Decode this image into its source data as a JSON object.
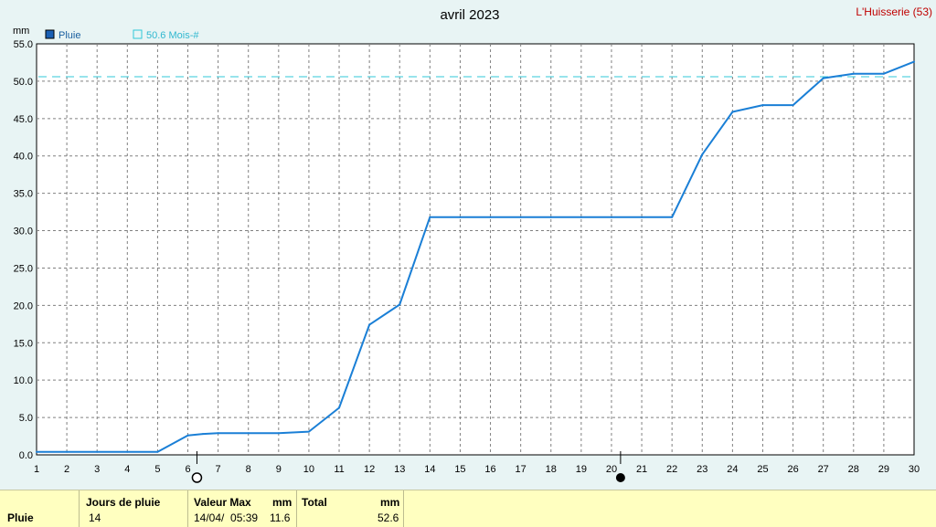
{
  "title": "avril 2023",
  "station": "L'Huisserie (53)",
  "y_unit": "mm",
  "legend": {
    "series_label": "Pluie",
    "reference_label": "50.6 Mois-#",
    "series_color": "#1a7fd6",
    "reference_color": "#30c8d8"
  },
  "chart_data": {
    "type": "line",
    "title": "avril 2023",
    "ylabel": "mm",
    "xlabel": "",
    "x": [
      1,
      2,
      3,
      4,
      5,
      6,
      6.5,
      7,
      8,
      9,
      10,
      11,
      12,
      13,
      14,
      15,
      16,
      17,
      18,
      19,
      20,
      21,
      22,
      23,
      24,
      25,
      26,
      27,
      28,
      29,
      30
    ],
    "series": [
      {
        "name": "Pluie",
        "values": [
          0.4,
          0.4,
          0.4,
          0.4,
          0.4,
          2.6,
          2.8,
          2.9,
          2.9,
          2.9,
          3.1,
          6.3,
          17.4,
          20.1,
          31.8,
          31.8,
          31.8,
          31.8,
          31.8,
          31.8,
          31.8,
          31.8,
          31.8,
          40.2,
          45.9,
          46.8,
          46.8,
          50.4,
          51.0,
          51.0,
          52.6
        ]
      }
    ],
    "reference_line": {
      "label": "50.6 Mois-#",
      "value": 50.6
    },
    "ylim": [
      0,
      55
    ],
    "xlim": [
      1,
      30
    ],
    "y_ticks": [
      "0.0",
      "5.0",
      "10.0",
      "15.0",
      "20.0",
      "25.0",
      "30.0",
      "35.0",
      "40.0",
      "45.0",
      "50.0",
      "55.0"
    ],
    "x_ticks": [
      "1",
      "2",
      "3",
      "4",
      "5",
      "6",
      "7",
      "8",
      "9",
      "10",
      "11",
      "12",
      "13",
      "14",
      "15",
      "16",
      "17",
      "18",
      "19",
      "20",
      "21",
      "22",
      "23",
      "24",
      "25",
      "26",
      "27",
      "28",
      "29",
      "30"
    ],
    "moon_phases": [
      {
        "day": 6.3,
        "phase": "full"
      },
      {
        "day": 20.3,
        "phase": "new"
      }
    ],
    "grid": true,
    "legend_position": "top-left"
  },
  "summary": {
    "row_label": "Pluie",
    "days_header": "Jours de pluie",
    "days_value": "14",
    "max_header": "Valeur Max",
    "max_unit": "mm",
    "max_datetime": "14/04/  05:39",
    "max_value": "11.6",
    "total_header": "Total",
    "total_unit": "mm",
    "total_value": "52.6"
  }
}
